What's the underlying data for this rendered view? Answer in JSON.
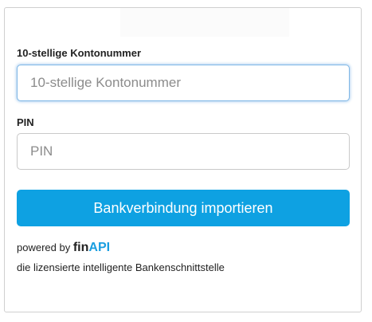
{
  "form": {
    "account_label": "10-stellige Kontonummer",
    "account_placeholder": "10-stellige Kontonummer",
    "pin_label": "PIN",
    "pin_placeholder": "PIN",
    "submit_label": "Bankverbindung importieren"
  },
  "footer": {
    "powered_by": "powered by",
    "brand_part1": "fin",
    "brand_part2": "API",
    "tagline": "die lizensierte intelligente Bankenschnittstelle"
  },
  "colors": {
    "button": "#0ea1e2",
    "brand_accent": "#1a9ee0",
    "focus_border": "#7fb7e6"
  }
}
